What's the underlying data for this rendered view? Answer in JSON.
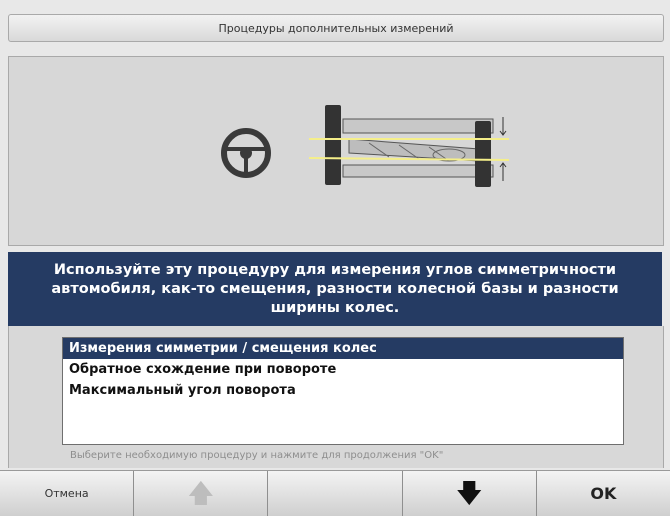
{
  "header": {
    "title": "Процедуры дополнительных измерений"
  },
  "description": {
    "text": "Используйте эту процедуру для измерения углов симметричности автомобиля, как-то смещения, разности колесной базы и разности ширины колес."
  },
  "procedures": {
    "items": [
      "Измерения симметрии / смещения колес",
      "Обратное схождение при повороте",
      "Максимальный угол поворота"
    ],
    "selected_index": 0
  },
  "hint": {
    "text": "Выберите необходимую процедуру и нажмите для продолжения \"OK\""
  },
  "toolbar": {
    "cancel_label": "Отмена",
    "up_icon": "arrow-up-icon",
    "down_icon": "arrow-down-icon",
    "ok_label": "OK"
  },
  "colors": {
    "accent": "#253b63",
    "panel": "#d7d7d7",
    "guide_line": "#f5ef8a"
  }
}
